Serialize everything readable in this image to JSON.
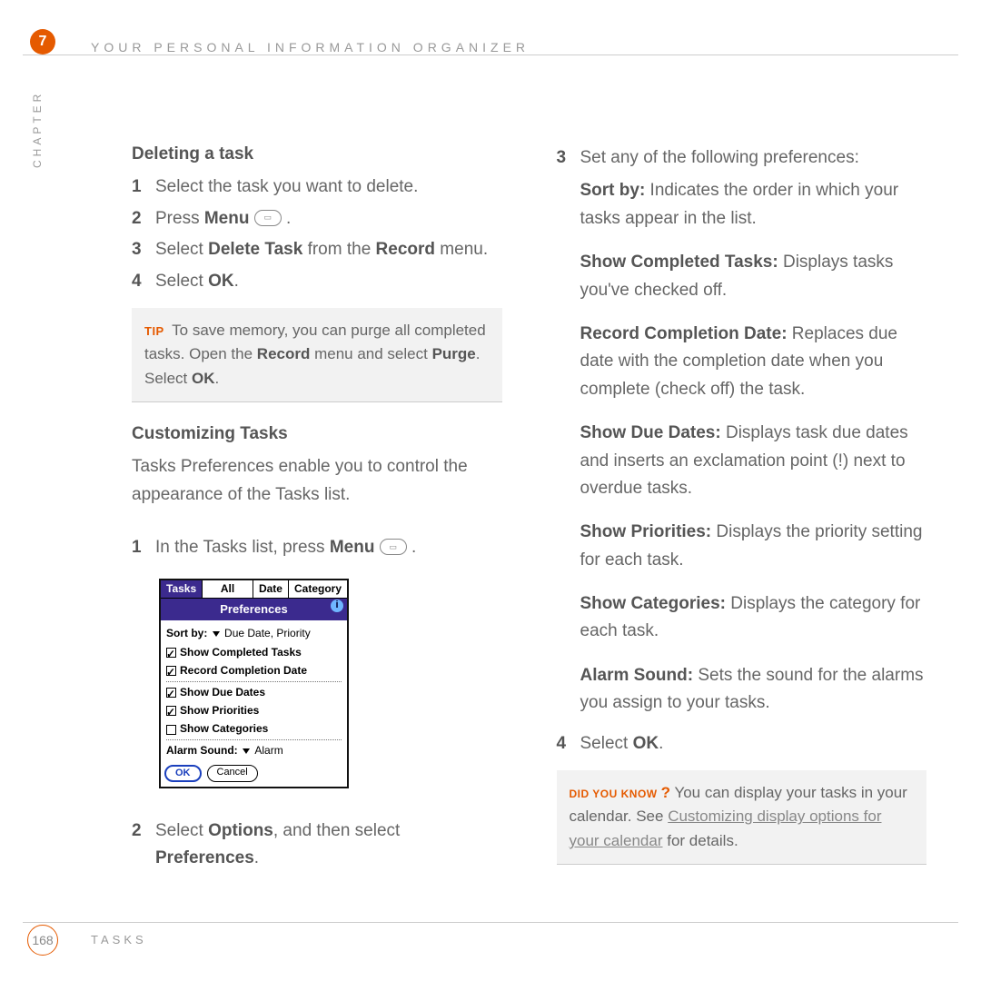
{
  "chapter_number": "7",
  "running_head": "YOUR PERSONAL INFORMATION ORGANIZER",
  "chapter_label": "CHAPTER",
  "left": {
    "h_delete": "Deleting a task",
    "s1": "Select the task you want to delete.",
    "s2a": "Press ",
    "s2b": "Menu",
    "s2c": " .",
    "s3a": "Select ",
    "s3b": "Delete Task",
    "s3c": " from the ",
    "s3d": "Record",
    "s3e": " menu.",
    "s4a": "Select ",
    "s4b": "OK",
    "s4c": ".",
    "tip_label": "TIP",
    "tip1": "To save memory, you can purge all completed tasks. Open the ",
    "tip2": "Record",
    "tip3": " menu and select ",
    "tip4": "Purge",
    "tip5": ". Select ",
    "tip6": "OK",
    "tip7": ".",
    "h_customize": "Customizing Tasks",
    "customize_intro": "Tasks Preferences enable you to control the appearance of the Tasks list.",
    "c1a": "In the Tasks list, press ",
    "c1b": "Menu",
    "c1c": " .",
    "c2a": "Select ",
    "c2b": "Options",
    "c2c": ", and then select ",
    "c2d": "Preferences",
    "c2e": "."
  },
  "screenshot": {
    "tabs": {
      "t1": "Tasks",
      "t2": "All",
      "t3": "Date",
      "t4": "Category"
    },
    "title": "Preferences",
    "sortby_label": "Sort by:",
    "sortby_value": "Due Date, Priority",
    "r1": "Show Completed Tasks",
    "r2": "Record Completion Date",
    "r3": "Show Due Dates",
    "r4": "Show Priorities",
    "r5": "Show Categories",
    "alarm_label": "Alarm Sound:",
    "alarm_value": "Alarm",
    "ok": "OK",
    "cancel": "Cancel"
  },
  "right": {
    "s3": "Set any of the following preferences:",
    "p1a": "Sort by:",
    "p1b": " Indicates the order in which your tasks appear in the list.",
    "p2a": "Show Completed Tasks:",
    "p2b": " Displays tasks you've checked off.",
    "p3a": "Record Completion Date:",
    "p3b": " Replaces due date with the completion date when you complete (check off) the task.",
    "p4a": "Show Due Dates:",
    "p4b": " Displays task due dates and inserts an exclamation point (!) next to overdue tasks.",
    "p5a": "Show Priorities:",
    "p5b": " Displays the priority setting for each task.",
    "p6a": "Show Categories:",
    "p6b": " Displays the category for each task.",
    "p7a": "Alarm Sound:",
    "p7b": " Sets the sound for the alarms you assign to your tasks.",
    "s4a": "Select ",
    "s4b": "OK",
    "s4c": ".",
    "dyk_label": "DID YOU KNOW",
    "dyk_q": "?",
    "dyk1": "You can display your tasks in your calendar. See ",
    "dyk_link": "Customizing display options for your calendar",
    "dyk2": " for details."
  },
  "page_number": "168",
  "footer_label": "TASKS"
}
